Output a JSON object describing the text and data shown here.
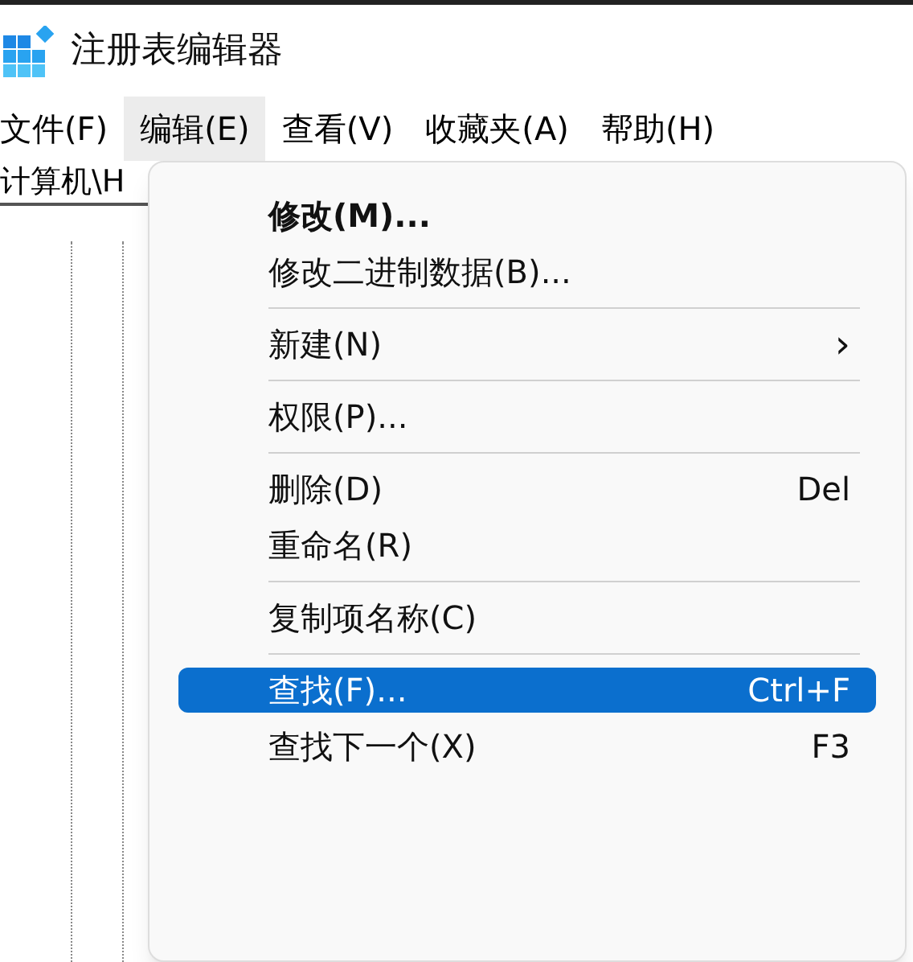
{
  "window": {
    "title": "注册表编辑器"
  },
  "menu_bar": [
    {
      "label": "文件(F)",
      "selected": false
    },
    {
      "label": "编辑(E)",
      "selected": true
    },
    {
      "label": "查看(V)",
      "selected": false
    },
    {
      "label": "收藏夹(A)",
      "selected": false
    },
    {
      "label": "帮助(H)",
      "selected": false
    }
  ],
  "address_bar": {
    "value": "计算机\\H"
  },
  "edit_menu": [
    {
      "kind": "item",
      "label": "修改(M)...",
      "default": true,
      "selected": false
    },
    {
      "kind": "item",
      "label": "修改二进制数据(B)...",
      "default": false,
      "selected": false
    },
    {
      "kind": "separator"
    },
    {
      "kind": "item",
      "label": "新建(N)",
      "default": false,
      "selected": false,
      "submenu": "›"
    },
    {
      "kind": "separator"
    },
    {
      "kind": "item",
      "label": "权限(P)...",
      "default": false,
      "selected": false
    },
    {
      "kind": "separator"
    },
    {
      "kind": "item",
      "label": "删除(D)",
      "default": false,
      "selected": false,
      "shortcut": "Del"
    },
    {
      "kind": "item",
      "label": "重命名(R)",
      "default": false,
      "selected": false
    },
    {
      "kind": "separator"
    },
    {
      "kind": "item",
      "label": "复制项名称(C)",
      "default": false,
      "selected": false
    },
    {
      "kind": "separator"
    },
    {
      "kind": "item",
      "label": "查找(F)...",
      "default": false,
      "selected": true,
      "shortcut": "Ctrl+F"
    },
    {
      "kind": "item",
      "label": "查找下一个(X)",
      "default": false,
      "selected": false,
      "shortcut": "F3"
    }
  ]
}
